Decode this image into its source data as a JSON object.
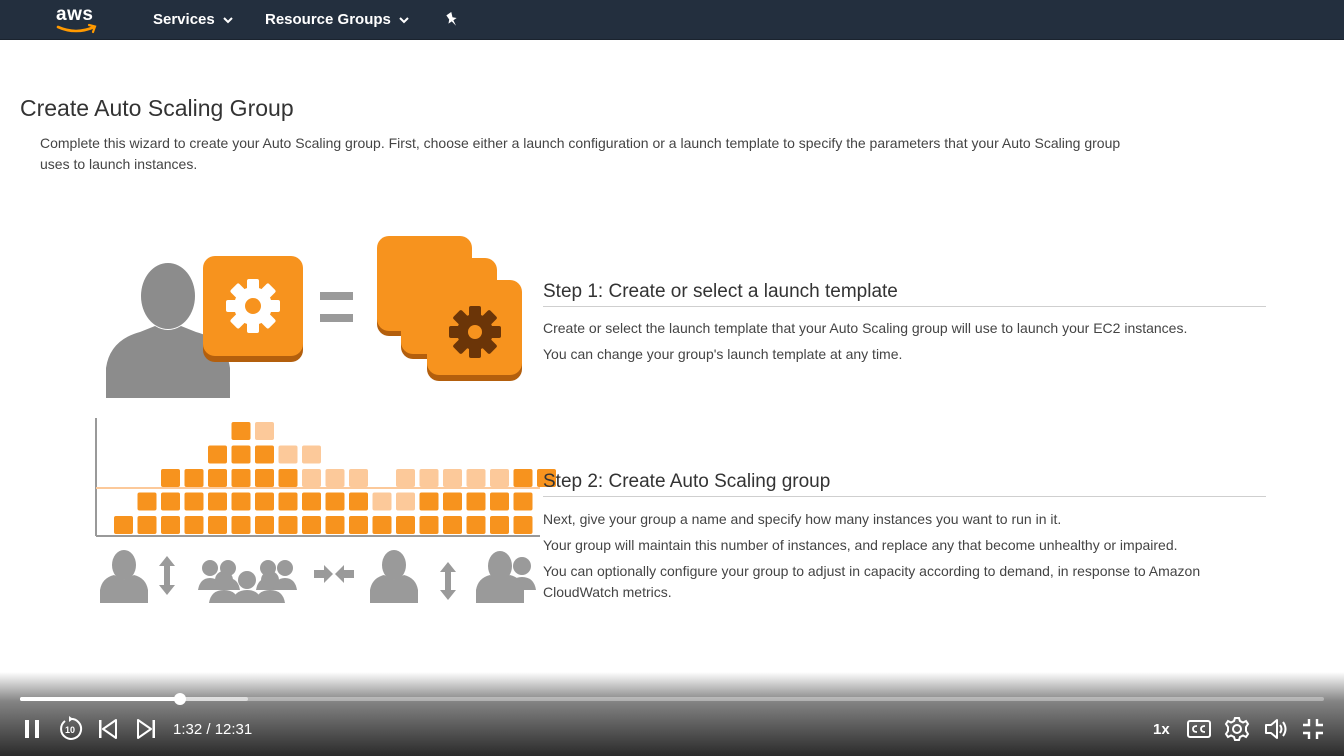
{
  "topbar": {
    "logo_text": "aws",
    "services_label": "Services",
    "resource_groups_label": "Resource Groups"
  },
  "page": {
    "title": "Create Auto Scaling Group",
    "intro": "Complete this wizard to create your Auto Scaling group. First, choose either a launch configuration or a launch template to specify the parameters that your Auto Scaling group uses to launch instances."
  },
  "step1": {
    "title": "Step 1: Create or select a launch template",
    "line1": "Create or select the launch template that your Auto Scaling group will use to launch your EC2 instances.",
    "line2": "You can change your group's launch template at any time."
  },
  "step2": {
    "title": "Step 2: Create Auto Scaling group",
    "line1": "Next, give your group a name and specify how many instances you want to run in it.",
    "line2": "Your group will maintain this number of instances, and replace any that become unhealthy or impaired.",
    "line3": "You can optionally configure your group to adjust in capacity according to demand, in response to Amazon CloudWatch metrics."
  },
  "player": {
    "elapsed": "1:32",
    "duration": "12:31",
    "time_display": "1:32 / 12:31",
    "progress_fraction": 0.123,
    "buffered_fraction": 0.175,
    "speed": "1x",
    "skip_back_seconds": "10"
  },
  "colors": {
    "aws_nav": "#232f3e",
    "aws_orange": "#ff9900",
    "tile_orange": "#f7931e",
    "tile_light": "#fcc99a",
    "person_gray": "#8c8c8c"
  },
  "icons": [
    "chevron-down-icon",
    "pin-icon",
    "gear-icon",
    "person-icon",
    "group-icon",
    "vertical-arrows-icon",
    "collapse-arrows-icon",
    "pause-icon",
    "replay-10-icon",
    "skip-previous-icon",
    "skip-next-icon",
    "closed-captions-icon",
    "settings-icon",
    "volume-icon",
    "exit-fullscreen-icon"
  ]
}
